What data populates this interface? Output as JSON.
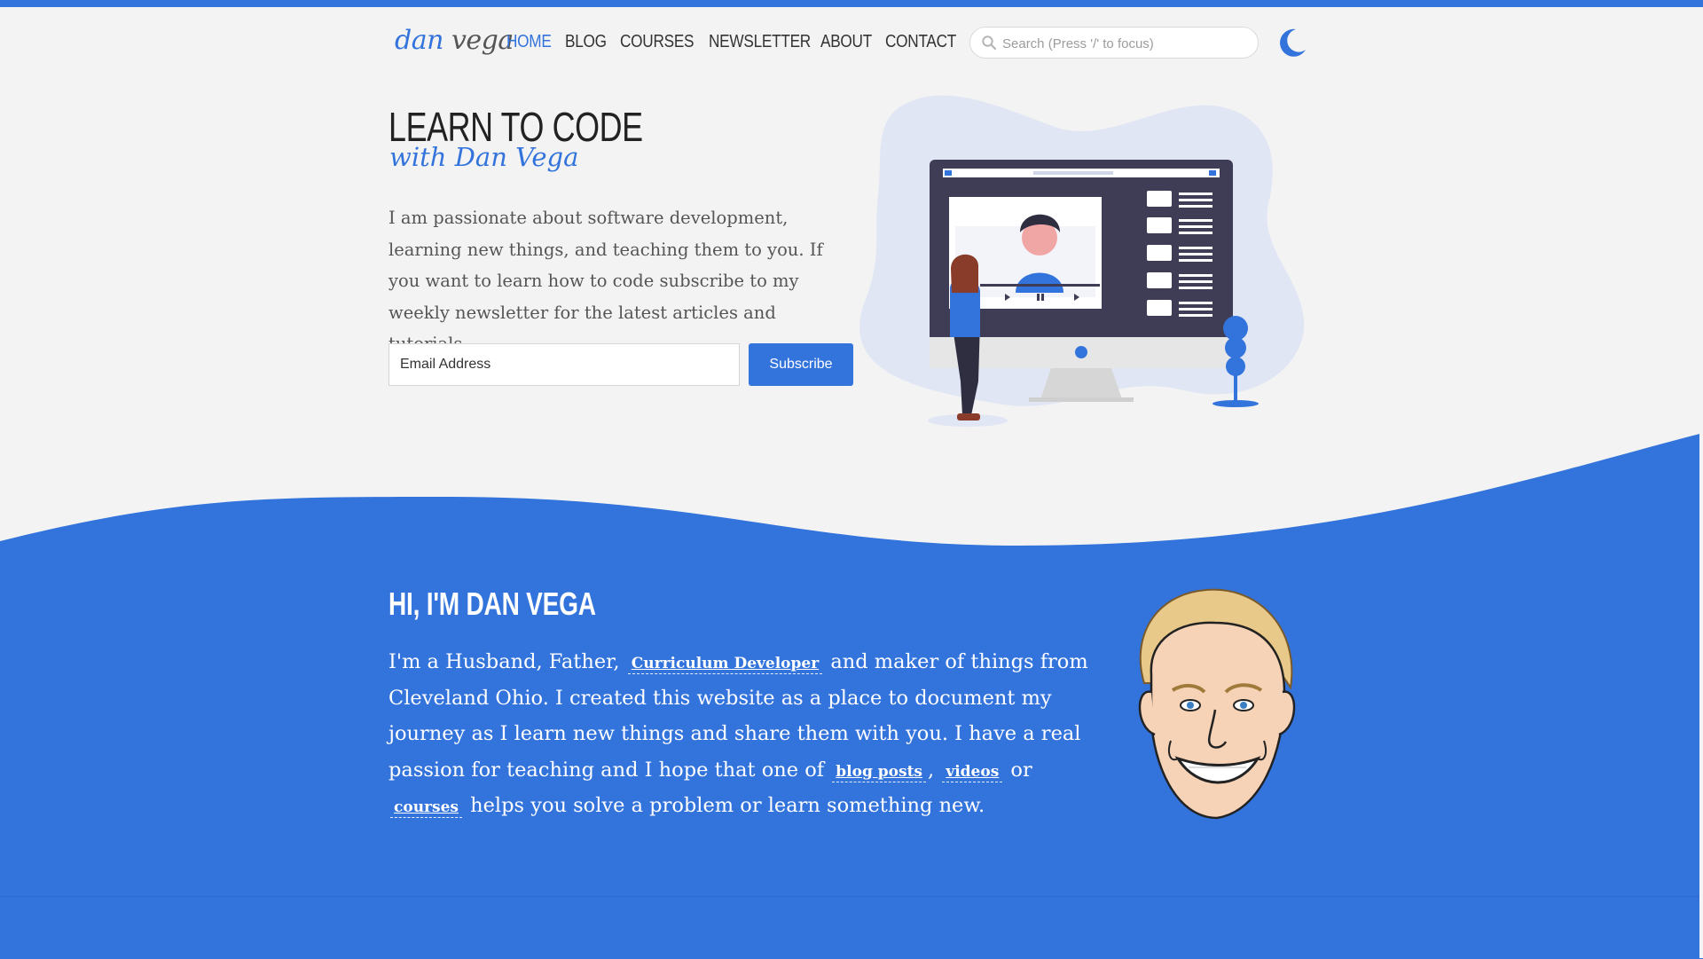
{
  "header": {
    "logo_first": "dan",
    "logo_last": "vega",
    "nav": [
      {
        "label": "HOME",
        "active": true
      },
      {
        "label": "BLOG",
        "active": false
      },
      {
        "label": "COURSES",
        "active": false
      },
      {
        "label": "NEWSLETTER",
        "active": false
      },
      {
        "label": "ABOUT",
        "active": false
      },
      {
        "label": "CONTACT",
        "active": false
      }
    ],
    "search_placeholder": "Search (Press '/' to focus)",
    "theme_icon": "moon-icon"
  },
  "hero": {
    "title": "LEARN TO CODE",
    "subtitle": "with Dan Vega",
    "description": "I am passionate about software development, learning new things, and teaching them to you. If you want to learn how to code subscribe to my weekly newsletter for the latest articles and tutorials.",
    "email_placeholder": "Email Address",
    "subscribe_label": "Subscribe"
  },
  "about": {
    "title": "HI, I'M DAN VEGA",
    "p1": "I'm a Husband, Father,",
    "link_curriculum": "Curriculum Developer",
    "p2": "and maker of things from Cleveland Ohio. I created this website as a place to document my journey as I learn new things and share them with you. I have a real passion for teaching and I hope that one of",
    "link_blog": "blog posts",
    "comma": ",",
    "link_videos": "videos",
    "or": "or",
    "link_courses": "courses",
    "p3": "helps you solve a problem or learn something new."
  },
  "colors": {
    "accent": "#3373dc",
    "background": "#f3f3f3",
    "text_dark": "#222222"
  }
}
